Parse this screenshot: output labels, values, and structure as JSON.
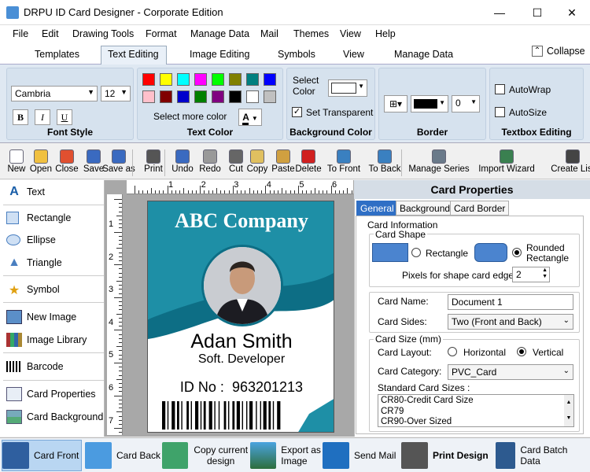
{
  "window": {
    "title": "DRPU ID Card Designer - Corporate Edition",
    "minimize": "—",
    "maximize": "☐",
    "close": "✕"
  },
  "menu": [
    "File",
    "Edit",
    "Drawing Tools",
    "Format",
    "Manage Data",
    "Mail",
    "Themes",
    "View",
    "Help"
  ],
  "ribbon_tabs": [
    "Templates",
    "Text Editing",
    "Image Editing",
    "Symbols",
    "View",
    "Manage Data"
  ],
  "collapse_label": "Collapse",
  "font_style": {
    "font": "Cambria",
    "size": "12",
    "bold": "B",
    "italic": "I",
    "underline": "U",
    "title": "Font Style"
  },
  "text_color": {
    "more": "Select more color",
    "title": "Text Color",
    "swatches": [
      "#ff0000",
      "#ffff00",
      "#00ffff",
      "#ff00ff",
      "#00ff00",
      "#808000",
      "#008080",
      "#0000ff",
      "#ffc0cb",
      "#800000",
      "#0000cc",
      "#008000",
      "#800080",
      "#000000",
      "#ffffff",
      "#c0c0c0"
    ]
  },
  "bg_color": {
    "select_color": "Select Color",
    "set_transparent": "Set Transparent",
    "title": "Background Color"
  },
  "border": {
    "value": "0",
    "title": "Border"
  },
  "textbox": {
    "autowrap": "AutoWrap",
    "autosize": "AutoSize",
    "title": "Textbox Editing"
  },
  "toolbar": [
    "New",
    "Open",
    "Close",
    "Save",
    "Save as",
    "Print",
    "Undo",
    "Redo",
    "Cut",
    "Copy",
    "Paste",
    "Delete",
    "To Front",
    "To Back",
    "Manage Series",
    "Import Wizard",
    "Create List"
  ],
  "left_panel": [
    "Text",
    "Rectangle",
    "Ellipse",
    "Triangle",
    "Symbol",
    "New Image",
    "Image Library",
    "Barcode",
    "Card Properties",
    "Card Background"
  ],
  "ruler_h": [
    "1",
    "2",
    "3",
    "4",
    "5",
    "6"
  ],
  "ruler_v": [
    "1",
    "2",
    "3",
    "4",
    "5",
    "6",
    "7"
  ],
  "card": {
    "company": "ABC Company",
    "name": "Adan Smith",
    "role": "Soft. Developer",
    "id_label": "ID No :",
    "id_value": "963201213"
  },
  "props": {
    "header": "Card Properties",
    "tabs": [
      "General",
      "Background",
      "Card Border"
    ],
    "card_information": "Card Information",
    "card_shape": "Card Shape",
    "rectangle": "Rectangle",
    "rounded_rectangle": "Rounded Rectangle",
    "pixels_label": "Pixels for shape card edge :",
    "pixels_value": "2",
    "card_name_label": "Card Name:",
    "card_name_value": "Document 1",
    "card_sides_label": "Card Sides:",
    "card_sides_value": "Two (Front and Back)",
    "card_size": "Card Size (mm)",
    "layout_label": "Card Layout:",
    "horizontal": "Horizontal",
    "vertical": "Vertical",
    "category_label": "Card Category:",
    "category_value": "PVC_Card",
    "standard_sizes": "Standard Card Sizes :",
    "sizes": [
      "CR80-Credit Card Size",
      "CR79",
      "CR90-Over Sized"
    ]
  },
  "bottom": [
    "Card Front",
    "Card Back",
    "Copy current design",
    "Export as Image",
    "Send Mail",
    "Print Design",
    "Card Batch Data"
  ]
}
